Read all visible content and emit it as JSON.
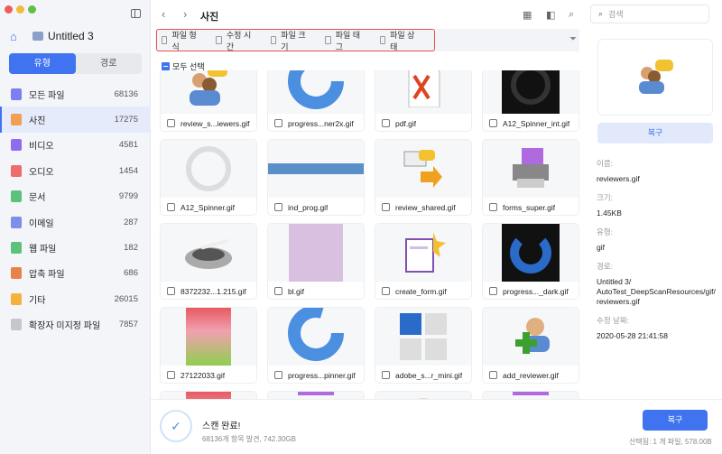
{
  "window": {
    "controls": [
      "close",
      "minimize",
      "maximize"
    ]
  },
  "sidebar": {
    "project": "Untitled 3",
    "seg": [
      "유형",
      "경로"
    ],
    "items": [
      {
        "label": "모든 파일",
        "count": "68136",
        "color": "#7b7ff0"
      },
      {
        "label": "사진",
        "count": "17275",
        "color": "#f0a050"
      },
      {
        "label": "비디오",
        "count": "4581",
        "color": "#8e6cf0"
      },
      {
        "label": "오디오",
        "count": "1454",
        "color": "#ef6c6c"
      },
      {
        "label": "문서",
        "count": "9799",
        "color": "#5cc17a"
      },
      {
        "label": "이메일",
        "count": "287",
        "color": "#7d8fe8"
      },
      {
        "label": "웹 파일",
        "count": "182",
        "color": "#5cc17a"
      },
      {
        "label": "압축 파일",
        "count": "686",
        "color": "#e6834a"
      },
      {
        "label": "기타",
        "count": "26015",
        "color": "#f2b23c"
      },
      {
        "label": "확장자 미지정 파일",
        "count": "7857",
        "color": "#c5c7cc"
      }
    ]
  },
  "header": {
    "title": "사진"
  },
  "filters": [
    "파일 형식",
    "수정 시간",
    "파일 크기",
    "파일 태그",
    "파일 상태"
  ],
  "select_all": "모두 선택",
  "files": [
    {
      "name": "review_s...iewers.gif",
      "t": "people"
    },
    {
      "name": "progress...ner2x.gif",
      "t": "ring"
    },
    {
      "name": "pdf.gif",
      "t": "pdf"
    },
    {
      "name": "A12_Spinner_int.gif",
      "t": "dark"
    },
    {
      "name": "A12_Spinner.gif",
      "t": "grey"
    },
    {
      "name": "ind_prog.gif",
      "t": "bar"
    },
    {
      "name": "review_shared.gif",
      "t": "share"
    },
    {
      "name": "forms_super.gif",
      "t": "printer"
    },
    {
      "name": "8372232...1.215.gif",
      "t": "ash"
    },
    {
      "name": "bl.gif",
      "t": "lilac"
    },
    {
      "name": "create_form.gif",
      "t": "form"
    },
    {
      "name": "progress..._dark.gif",
      "t": "darkring"
    },
    {
      "name": "27122033.gif",
      "t": "pink"
    },
    {
      "name": "progress...pinner.gif",
      "t": "ring"
    },
    {
      "name": "adobe_s...r_mini.gif",
      "t": "blocks"
    },
    {
      "name": "add_reviewer.gif",
      "t": "add"
    },
    {
      "name": "",
      "t": "pink"
    },
    {
      "name": "",
      "t": "purple"
    },
    {
      "name": "",
      "t": "grey"
    },
    {
      "name": "",
      "t": "purple"
    }
  ],
  "scan": {
    "title": "스캔 완료!",
    "subtitle": "68136개 항목 발견, 742.30GB"
  },
  "search": {
    "placeholder": "검색"
  },
  "detail": {
    "recover": "복구",
    "fields": [
      {
        "k": "이름:",
        "v": "reviewers.gif"
      },
      {
        "k": "크기:",
        "v": "1.45KB"
      },
      {
        "k": "유형:",
        "v": "gif"
      },
      {
        "k": "경로:",
        "v": "Untitled 3/ AutoTest_DeepScanResources/gif/ reviewers.gif"
      },
      {
        "k": "수정 날짜:",
        "v": "2020-05-28 21:41:58"
      }
    ]
  },
  "footer": {
    "recover": "복구",
    "selection": "선택됨: 1 개 파일, 578.00B"
  }
}
